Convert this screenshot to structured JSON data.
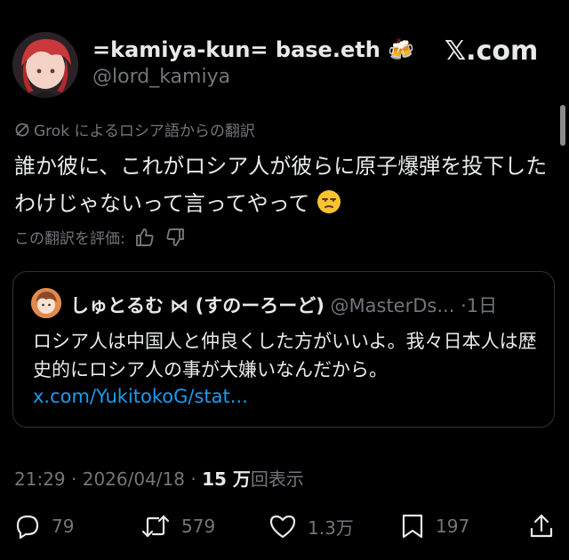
{
  "author": {
    "display_name": "=kamiya-kun= base.eth",
    "name_emoji": "🍻",
    "handle": "@lord_kamiya"
  },
  "site_logo": "𝕏.com",
  "translation": {
    "label": "Grok によるロシア語からの翻訳",
    "icon": "grok-icon"
  },
  "tweet": {
    "text": "誰か彼に、これがロシア人が彼らに原子爆弾を投下したわけじゃないって言ってやって",
    "emoji": "😒"
  },
  "rating": {
    "label": "この翻訳を評価:",
    "up_icon": "thumbs-up-icon",
    "down_icon": "thumbs-down-icon"
  },
  "quote": {
    "name": "しゅとるむ ⋈ (すのーろーど)",
    "handle": "@MasterDs...",
    "age": "1日",
    "text": "ロシア人は中国人と仲良くした方がいいよ。我々日本人は歴史的にロシア人の事が大嫌いなんだから。",
    "link": "x.com/YukitokoG/stat..."
  },
  "meta": {
    "time": "21:29",
    "date": "2026/04/18",
    "views_count": "15 万",
    "views_label": "回表示"
  },
  "actions": {
    "replies": "79",
    "reposts": "579",
    "likes": "1.3万",
    "bookmarks": "197"
  },
  "colors": {
    "background": "#000000",
    "text": "#e7e9ea",
    "muted": "#71767b",
    "link": "#1d9bf0",
    "border": "#2f3336"
  }
}
